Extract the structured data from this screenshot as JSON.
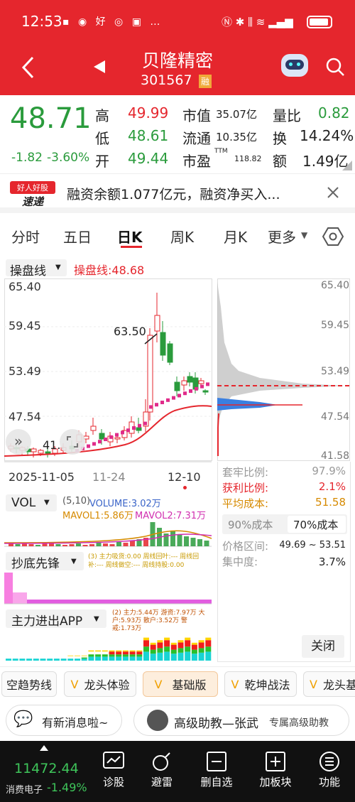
{
  "status": {
    "time": "12:53",
    "icons": "… "
  },
  "header": {
    "name": "贝隆精密",
    "code": "301567",
    "badge": "融"
  },
  "quote": {
    "price": "48.71",
    "change": "-1.82",
    "pct": "-3.60%",
    "high_label": "高",
    "high": "49.99",
    "low_label": "低",
    "low": "48.61",
    "open_label": "开",
    "open": "49.44",
    "mcap_label": "市值",
    "mcap": "35.07亿",
    "float_label": "流通",
    "float": "10.35亿",
    "pe_label": "市盈",
    "pe_sup": "TTM",
    "pe": "118.82",
    "volratio_label": "量比",
    "volratio": "0.82",
    "turnover_label": "换",
    "turnover": "14.24%",
    "amount_label": "额",
    "amount": "1.49亿"
  },
  "news": {
    "logo_top": "好人好股",
    "logo_bottom": "速递",
    "text": "融资余额1.077亿元，融资净买入..."
  },
  "tabs": [
    "分时",
    "五日",
    "日K",
    "周K",
    "月K",
    "更多"
  ],
  "chart": {
    "indicator": "操盘线",
    "indicator_value": "操盘线:48.68",
    "y_ticks": [
      "65.40",
      "59.45",
      "53.49",
      "47.54"
    ],
    "x_labels": [
      "2025-11-05",
      "11-24",
      "12-10"
    ],
    "max_label": "63.50",
    "min_label": "41.."
  },
  "chip": {
    "y_ticks": [
      "65.40",
      "59.45",
      "53.49",
      "47.54",
      "41.58"
    ],
    "rows": [
      {
        "label": "套牢比例:",
        "value": "97.9%"
      },
      {
        "label": "获利比例:",
        "value": "2.1%"
      },
      {
        "label": "平均成本:",
        "value": "51.58"
      }
    ],
    "cost_tabs": [
      "90%成本",
      "70%成本"
    ],
    "range_label": "价格区间:",
    "range": "49.69 ~ 53.51",
    "conc_label": "集中度:",
    "conc": "3.7%",
    "close": "关闭"
  },
  "vol": {
    "name": "VOL",
    "params": "(5,10)",
    "volume": "VOLUME:3.02万",
    "mavol1": "MAVOL1:5.86万",
    "mavol2": "MAVOL2:7.31万"
  },
  "ind2": {
    "name": "抄底先锋",
    "legend": "(3) 主力吸货:0.00 周线回叶:--- 周线回补:--- 周线做空:--- 周线持股:0.00"
  },
  "ind3": {
    "name": "主力进出APP",
    "legend": "(2) 主力:5.44万 游资:7.97万 大户:5.93万 散户:3.52万 警戒:1.73万"
  },
  "strategies": [
    "空趋势线",
    "龙头体验",
    "基础版",
    "乾坤战法",
    "龙头基"
  ],
  "msg": {
    "left": "有新消息啦~",
    "teacher": "高级助教—张武",
    "teacher_sub": "专属高级助教"
  },
  "bottom": {
    "index": "11472.44",
    "sector": "消费电子",
    "sector_pct": "-1.49%",
    "nav": [
      "诊股",
      "避雷",
      "删自选",
      "加板块",
      "功能"
    ]
  },
  "chart_data": {
    "type": "candlestick",
    "x": [
      "2025-11-05",
      "11-24",
      "12-10"
    ],
    "ylim": [
      41.58,
      65.4
    ],
    "colors": {
      "up": "#e5262d",
      "down": "#2a9b3c",
      "ma": "#e5262d",
      "cost": "#e02b8a"
    }
  }
}
